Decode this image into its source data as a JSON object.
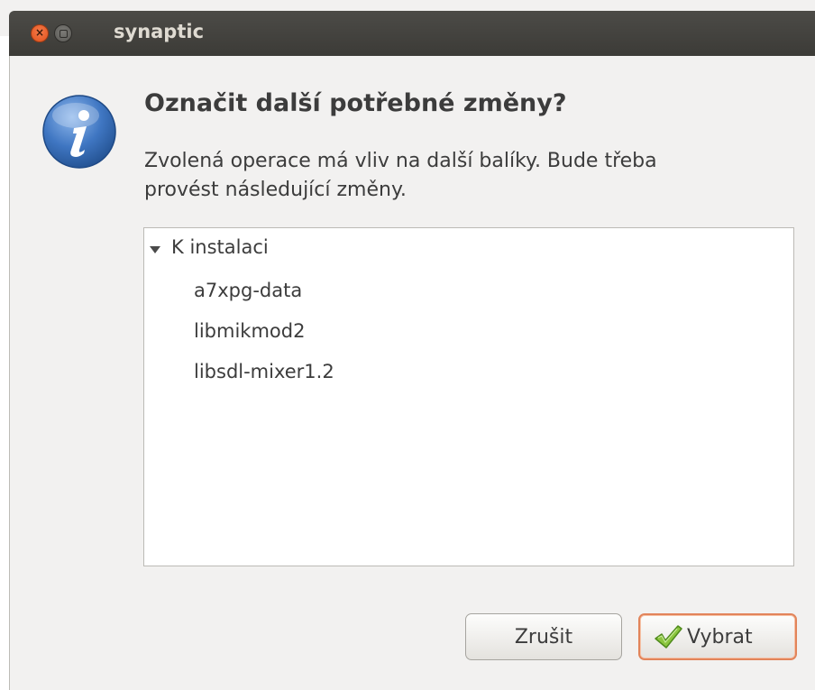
{
  "window": {
    "title": "synaptic"
  },
  "dialog": {
    "icon": "info-icon",
    "heading": "Označit další potřebné změny?",
    "message_line1": "Zvolená operace má vliv na další balíky. Bude třeba",
    "message_line2": "provést následující změny."
  },
  "changes": {
    "group_label": "K instalaci",
    "packages": [
      "a7xpg-data",
      "libmikmod2",
      "libsdl-mixer1.2"
    ]
  },
  "buttons": {
    "cancel_label": "Zrušit",
    "confirm_label": "Vybrat",
    "confirm_icon": "checkmark-icon"
  },
  "colors": {
    "titlebar": "#3c3b37",
    "close_button": "#e0521c",
    "default_button_border": "#e2845a",
    "info_icon": "#3b6fb8"
  }
}
